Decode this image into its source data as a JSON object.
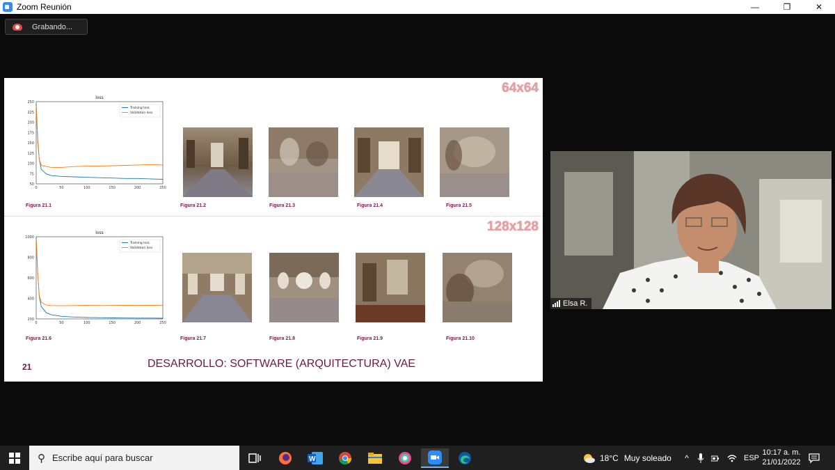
{
  "window": {
    "title": "Zoom Reunión",
    "controls": [
      "—",
      "❐",
      "✕"
    ]
  },
  "recording": {
    "label": "Grabando..."
  },
  "slide": {
    "res_top": "64x64",
    "res_bottom": "128x128",
    "number": "21",
    "title": "DESARROLLO: SOFTWARE (ARQUITECTURA) VAE",
    "captions": {
      "top": [
        "Figura 21.1",
        "Figura 21.2",
        "Figura 21.3",
        "Figura 21.4",
        "Figura 21.5"
      ],
      "bottom": [
        "Figura 21.6",
        "Figura 21.7",
        "Figura 21.8",
        "Figura 21.9",
        "Figura 21.10"
      ]
    }
  },
  "chart_data": [
    {
      "type": "line",
      "title": "loss",
      "ylim": [
        50,
        250
      ],
      "yticks": [
        50,
        75,
        100,
        125,
        150,
        175,
        200,
        225,
        250
      ],
      "xticks": [
        0,
        50,
        100,
        150,
        200,
        250
      ],
      "legend_position": "top-right",
      "series": [
        {
          "name": "Training loss",
          "color": "#1f77b4",
          "x": [
            0,
            3,
            6,
            10,
            20,
            30,
            50,
            75,
            100,
            125,
            150,
            175,
            200,
            225,
            250
          ],
          "y": [
            245,
            160,
            110,
            85,
            74,
            70,
            68,
            67,
            66,
            65,
            64,
            63,
            63,
            62,
            61
          ]
        },
        {
          "name": "Validation loss",
          "color": "#ff7f0e",
          "x": [
            0,
            3,
            6,
            10,
            20,
            30,
            50,
            75,
            100,
            125,
            150,
            175,
            200,
            225,
            250
          ],
          "y": [
            240,
            150,
            110,
            95,
            92,
            90,
            90,
            92,
            93,
            93,
            94,
            95,
            96,
            97,
            96
          ]
        }
      ]
    },
    {
      "type": "line",
      "title": "loss",
      "ylim": [
        200,
        1000
      ],
      "yticks": [
        200,
        400,
        600,
        800,
        1000
      ],
      "xticks": [
        0,
        50,
        100,
        150,
        200,
        250
      ],
      "legend_position": "top-right",
      "series": [
        {
          "name": "Training loss",
          "color": "#1f77b4",
          "x": [
            0,
            3,
            6,
            10,
            20,
            30,
            50,
            75,
            100,
            125,
            150,
            175,
            200,
            225,
            250
          ],
          "y": [
            1000,
            650,
            420,
            320,
            260,
            240,
            225,
            218,
            214,
            212,
            210,
            209,
            208,
            208,
            207
          ]
        },
        {
          "name": "Validation loss",
          "color": "#ff7f0e",
          "x": [
            0,
            3,
            6,
            10,
            20,
            30,
            50,
            75,
            100,
            125,
            150,
            175,
            200,
            225,
            250
          ],
          "y": [
            980,
            640,
            430,
            360,
            335,
            330,
            328,
            330,
            332,
            330,
            331,
            332,
            333,
            332,
            331
          ]
        }
      ]
    }
  ],
  "video": {
    "participant": "Elsa R."
  },
  "taskbar": {
    "search_placeholder": "Escribe aquí para buscar",
    "weather_temp": "18°C",
    "weather_text": "Muy soleado",
    "lang": "ESP",
    "time": "10:17 a. m.",
    "date": "21/01/2022"
  }
}
